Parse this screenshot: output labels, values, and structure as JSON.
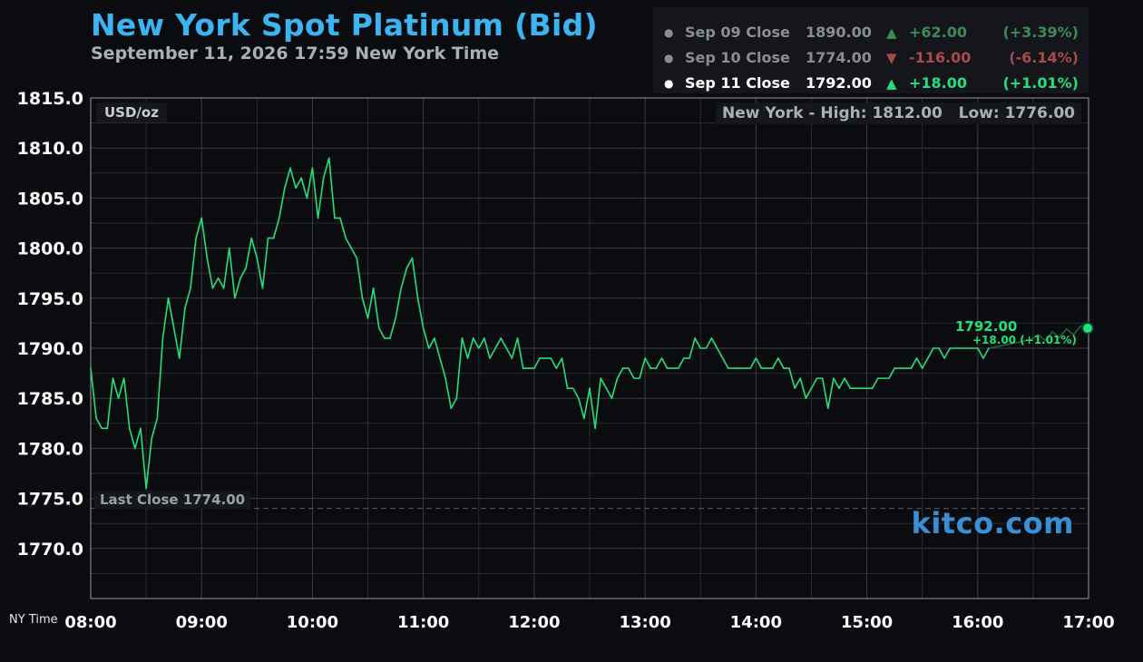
{
  "header": {
    "title": "New York Spot Platinum (Bid)",
    "subtitle": "September 11, 2026 17:59 New York Time"
  },
  "closes": [
    {
      "label": "Sep 09 Close",
      "value": "1890.00",
      "arrow": "▲",
      "change": "+62.00",
      "pct": "(+3.39%)",
      "direction": "up",
      "current": false
    },
    {
      "label": "Sep 10 Close",
      "value": "1774.00",
      "arrow": "▼",
      "change": "-116.00",
      "pct": "(-6.14%)",
      "direction": "down",
      "current": false
    },
    {
      "label": "Sep 11 Close",
      "value": "1792.00",
      "arrow": "▲",
      "change": "+18.00",
      "pct": "(+1.01%)",
      "direction": "up",
      "current": true
    }
  ],
  "labels": {
    "unit": "USD/oz",
    "high_low": "New York - High: 1812.00   Low: 1776.00",
    "last_close": "Last Close 1774.00",
    "brand": "kitco.com",
    "ny_time": "NY Time",
    "current_value": "1792.00",
    "current_change": "+18.00 (+1.01%)"
  },
  "colors": {
    "background": "#0b0c10",
    "title": "#3db4f2",
    "line": "#22e07a",
    "grid": "#3a3c42",
    "brand": "#3a8fd4"
  },
  "chart_data": {
    "type": "line",
    "title": "New York Spot Platinum (Bid)",
    "ylabel": "USD/oz",
    "xlabel": "NY Time",
    "ylim": [
      1765,
      1815
    ],
    "xlim": [
      "08:00",
      "17:00"
    ],
    "yticks": [
      "1815.0",
      "1810.0",
      "1805.0",
      "1800.0",
      "1795.0",
      "1790.0",
      "1785.0",
      "1780.0",
      "1775.0",
      "1770.0"
    ],
    "xticks": [
      "08:00",
      "09:00",
      "10:00",
      "11:00",
      "12:00",
      "13:00",
      "14:00",
      "15:00",
      "16:00",
      "17:00"
    ],
    "grid": true,
    "last_close": 1774.0,
    "high": 1812.0,
    "low": 1776.0,
    "series": [
      {
        "points": [
          [
            "08:00",
            1788
          ],
          [
            "08:03",
            1783
          ],
          [
            "08:06",
            1782
          ],
          [
            "08:09",
            1782
          ],
          [
            "08:12",
            1787
          ],
          [
            "08:15",
            1785
          ],
          [
            "08:18",
            1787
          ],
          [
            "08:21",
            1782
          ],
          [
            "08:24",
            1780
          ],
          [
            "08:27",
            1782
          ],
          [
            "08:30",
            1776
          ],
          [
            "08:33",
            1781
          ],
          [
            "08:36",
            1783
          ],
          [
            "08:39",
            1791
          ],
          [
            "08:42",
            1795
          ],
          [
            "08:45",
            1792
          ],
          [
            "08:48",
            1789
          ],
          [
            "08:51",
            1794
          ],
          [
            "08:54",
            1796
          ],
          [
            "08:57",
            1801
          ],
          [
            "09:00",
            1803
          ],
          [
            "09:03",
            1799
          ],
          [
            "09:06",
            1796
          ],
          [
            "09:09",
            1797
          ],
          [
            "09:12",
            1796
          ],
          [
            "09:15",
            1800
          ],
          [
            "09:18",
            1795
          ],
          [
            "09:21",
            1797
          ],
          [
            "09:24",
            1798
          ],
          [
            "09:27",
            1801
          ],
          [
            "09:30",
            1799
          ],
          [
            "09:33",
            1796
          ],
          [
            "09:36",
            1801
          ],
          [
            "09:39",
            1801
          ],
          [
            "09:42",
            1803
          ],
          [
            "09:45",
            1806
          ],
          [
            "09:48",
            1808
          ],
          [
            "09:51",
            1806
          ],
          [
            "09:54",
            1807
          ],
          [
            "09:57",
            1805
          ],
          [
            "10:00",
            1808
          ],
          [
            "10:03",
            1803
          ],
          [
            "10:06",
            1807
          ],
          [
            "10:09",
            1809
          ],
          [
            "10:12",
            1803
          ],
          [
            "10:15",
            1803
          ],
          [
            "10:18",
            1801
          ],
          [
            "10:21",
            1800
          ],
          [
            "10:24",
            1799
          ],
          [
            "10:27",
            1795
          ],
          [
            "10:30",
            1793
          ],
          [
            "10:33",
            1796
          ],
          [
            "10:36",
            1792
          ],
          [
            "10:39",
            1791
          ],
          [
            "10:42",
            1791
          ],
          [
            "10:45",
            1793
          ],
          [
            "10:48",
            1796
          ],
          [
            "10:51",
            1798
          ],
          [
            "10:54",
            1799
          ],
          [
            "10:57",
            1795
          ],
          [
            "11:00",
            1792
          ],
          [
            "11:03",
            1790
          ],
          [
            "11:06",
            1791
          ],
          [
            "11:09",
            1789
          ],
          [
            "11:12",
            1787
          ],
          [
            "11:15",
            1784
          ],
          [
            "11:18",
            1785
          ],
          [
            "11:21",
            1791
          ],
          [
            "11:24",
            1789
          ],
          [
            "11:27",
            1791
          ],
          [
            "11:30",
            1790
          ],
          [
            "11:33",
            1791
          ],
          [
            "11:36",
            1789
          ],
          [
            "11:39",
            1790
          ],
          [
            "11:42",
            1791
          ],
          [
            "11:45",
            1790
          ],
          [
            "11:48",
            1789
          ],
          [
            "11:51",
            1791
          ],
          [
            "11:54",
            1788
          ],
          [
            "11:57",
            1788
          ],
          [
            "12:00",
            1788
          ],
          [
            "12:03",
            1789
          ],
          [
            "12:06",
            1789
          ],
          [
            "12:09",
            1789
          ],
          [
            "12:12",
            1788
          ],
          [
            "12:15",
            1789
          ],
          [
            "12:18",
            1786
          ],
          [
            "12:21",
            1786
          ],
          [
            "12:24",
            1785
          ],
          [
            "12:27",
            1783
          ],
          [
            "12:30",
            1786
          ],
          [
            "12:33",
            1782
          ],
          [
            "12:36",
            1787
          ],
          [
            "12:39",
            1786
          ],
          [
            "12:42",
            1785
          ],
          [
            "12:45",
            1787
          ],
          [
            "12:48",
            1788
          ],
          [
            "12:51",
            1788
          ],
          [
            "12:54",
            1787
          ],
          [
            "12:57",
            1787
          ],
          [
            "13:00",
            1789
          ],
          [
            "13:03",
            1788
          ],
          [
            "13:06",
            1788
          ],
          [
            "13:09",
            1789
          ],
          [
            "13:12",
            1788
          ],
          [
            "13:15",
            1788
          ],
          [
            "13:18",
            1788
          ],
          [
            "13:21",
            1789
          ],
          [
            "13:24",
            1789
          ],
          [
            "13:27",
            1791
          ],
          [
            "13:30",
            1790
          ],
          [
            "13:33",
            1790
          ],
          [
            "13:36",
            1791
          ],
          [
            "13:39",
            1790
          ],
          [
            "13:42",
            1789
          ],
          [
            "13:45",
            1788
          ],
          [
            "13:48",
            1788
          ],
          [
            "13:51",
            1788
          ],
          [
            "13:54",
            1788
          ],
          [
            "13:57",
            1788
          ],
          [
            "14:00",
            1789
          ],
          [
            "14:03",
            1788
          ],
          [
            "14:06",
            1788
          ],
          [
            "14:09",
            1788
          ],
          [
            "14:12",
            1789
          ],
          [
            "14:15",
            1788
          ],
          [
            "14:18",
            1788
          ],
          [
            "14:21",
            1786
          ],
          [
            "14:24",
            1787
          ],
          [
            "14:27",
            1785
          ],
          [
            "14:30",
            1786
          ],
          [
            "14:33",
            1787
          ],
          [
            "14:36",
            1787
          ],
          [
            "14:39",
            1784
          ],
          [
            "14:42",
            1787
          ],
          [
            "14:45",
            1786
          ],
          [
            "14:48",
            1787
          ],
          [
            "14:51",
            1786
          ],
          [
            "14:54",
            1786
          ],
          [
            "14:57",
            1786
          ],
          [
            "15:00",
            1786
          ],
          [
            "15:03",
            1786
          ],
          [
            "15:06",
            1787
          ],
          [
            "15:09",
            1787
          ],
          [
            "15:12",
            1787
          ],
          [
            "15:15",
            1788
          ],
          [
            "15:18",
            1788
          ],
          [
            "15:21",
            1788
          ],
          [
            "15:24",
            1788
          ],
          [
            "15:27",
            1789
          ],
          [
            "15:30",
            1788
          ],
          [
            "15:33",
            1789
          ],
          [
            "15:36",
            1790
          ],
          [
            "15:39",
            1790
          ],
          [
            "15:42",
            1789
          ],
          [
            "15:45",
            1790
          ],
          [
            "15:48",
            1790
          ],
          [
            "15:51",
            1790
          ],
          [
            "15:54",
            1790
          ],
          [
            "15:57",
            1790
          ],
          [
            "16:00",
            1790
          ],
          [
            "16:03",
            1789
          ],
          [
            "16:06",
            1790
          ]
        ]
      }
    ],
    "annotations": [
      "Last Close 1774.00",
      "1792.00",
      "+18.00 (+1.01%)"
    ]
  }
}
